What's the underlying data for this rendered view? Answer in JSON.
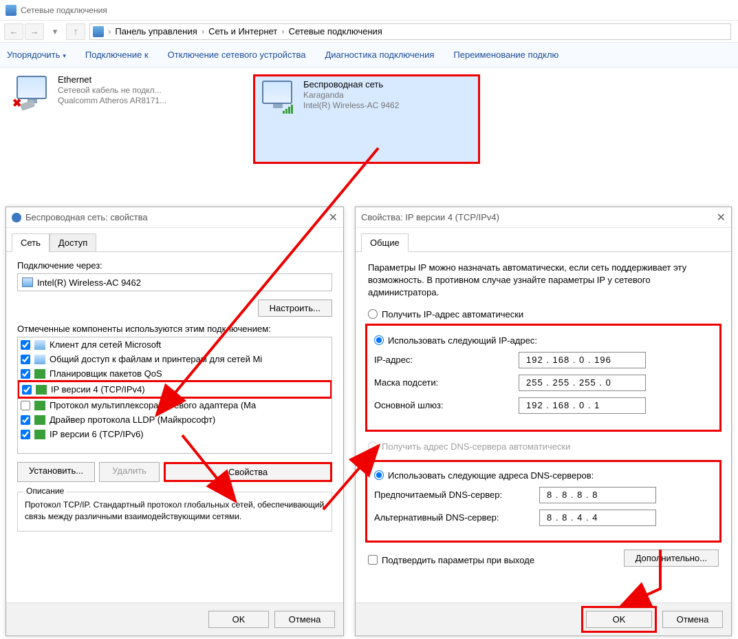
{
  "window": {
    "title": "Сетевые подключения"
  },
  "breadcrumb": {
    "seg1": "Панель управления",
    "seg2": "Сеть и Интернет",
    "seg3": "Сетевые подключения"
  },
  "cmdbar": {
    "organize": "Упорядочить",
    "connect": "Подключение к",
    "disable": "Отключение сетевого устройства",
    "diag": "Диагностика подключения",
    "rename": "Переименование подклю"
  },
  "conn_eth": {
    "title": "Ethernet",
    "sub1": "Сетевой кабель не подкл...",
    "sub2": "Qualcomm Atheros AR8171..."
  },
  "conn_wifi": {
    "title": "Беспроводная сеть",
    "sub1": "Karaganda",
    "sub2": "Intel(R) Wireless-AC 9462"
  },
  "d1": {
    "title": "Беспроводная сеть: свойства",
    "tab1": "Сеть",
    "tab2": "Доступ",
    "connect_via": "Подключение через:",
    "adapter": "Intel(R) Wireless-AC 9462",
    "configure": "Настроить...",
    "components_label": "Отмеченные компоненты используются этим подключением:",
    "items": [
      "Клиент для сетей Microsoft",
      "Общий доступ к файлам и принтерам для сетей Mi",
      "Планировщик пакетов QoS",
      "IP версии 4 (TCP/IPv4)",
      "Протокол мультиплексора сетевого адаптера (Ma",
      "Драйвер протокола LLDP (Майкрософт)",
      "IP версии 6 (TCP/IPv6)"
    ],
    "install": "Установить...",
    "remove": "Удалить",
    "properties": "Свойства",
    "desc_legend": "Описание",
    "desc_text": "Протокол TCP/IP. Стандартный протокол глобальных сетей, обеспечивающий связь между различными взаимодействующими сетями.",
    "ok": "OK",
    "cancel": "Отмена"
  },
  "d2": {
    "title": "Свойства: IP версии 4 (TCP/IPv4)",
    "tab1": "Общие",
    "intro": "Параметры IP можно назначать автоматически, если сеть поддерживает эту возможность. В противном случае узнайте параметры IP у сетевого администратора.",
    "r_auto_ip": "Получить IP-адрес автоматически",
    "r_manual_ip": "Использовать следующий IP-адрес:",
    "ip_label": "IP-адрес:",
    "ip_value": "192 . 168 .  0  . 196",
    "mask_label": "Маска подсети:",
    "mask_value": "255 . 255 . 255 .  0",
    "gw_label": "Основной шлюз:",
    "gw_value": "192 . 168 .  0  .  1",
    "r_auto_dns": "Получить адрес DNS-сервера автоматически",
    "r_manual_dns": "Использовать следующие адреса DNS-серверов:",
    "dns1_label": "Предпочитаемый DNS-сервер:",
    "dns1_value": "8  .  8  .  8  .  8",
    "dns2_label": "Альтернативный DNS-сервер:",
    "dns2_value": "8  .  8  .  4  .  4",
    "confirm_exit": "Подтвердить параметры при выходе",
    "advanced": "Дополнительно...",
    "ok": "OK",
    "cancel": "Отмена"
  }
}
